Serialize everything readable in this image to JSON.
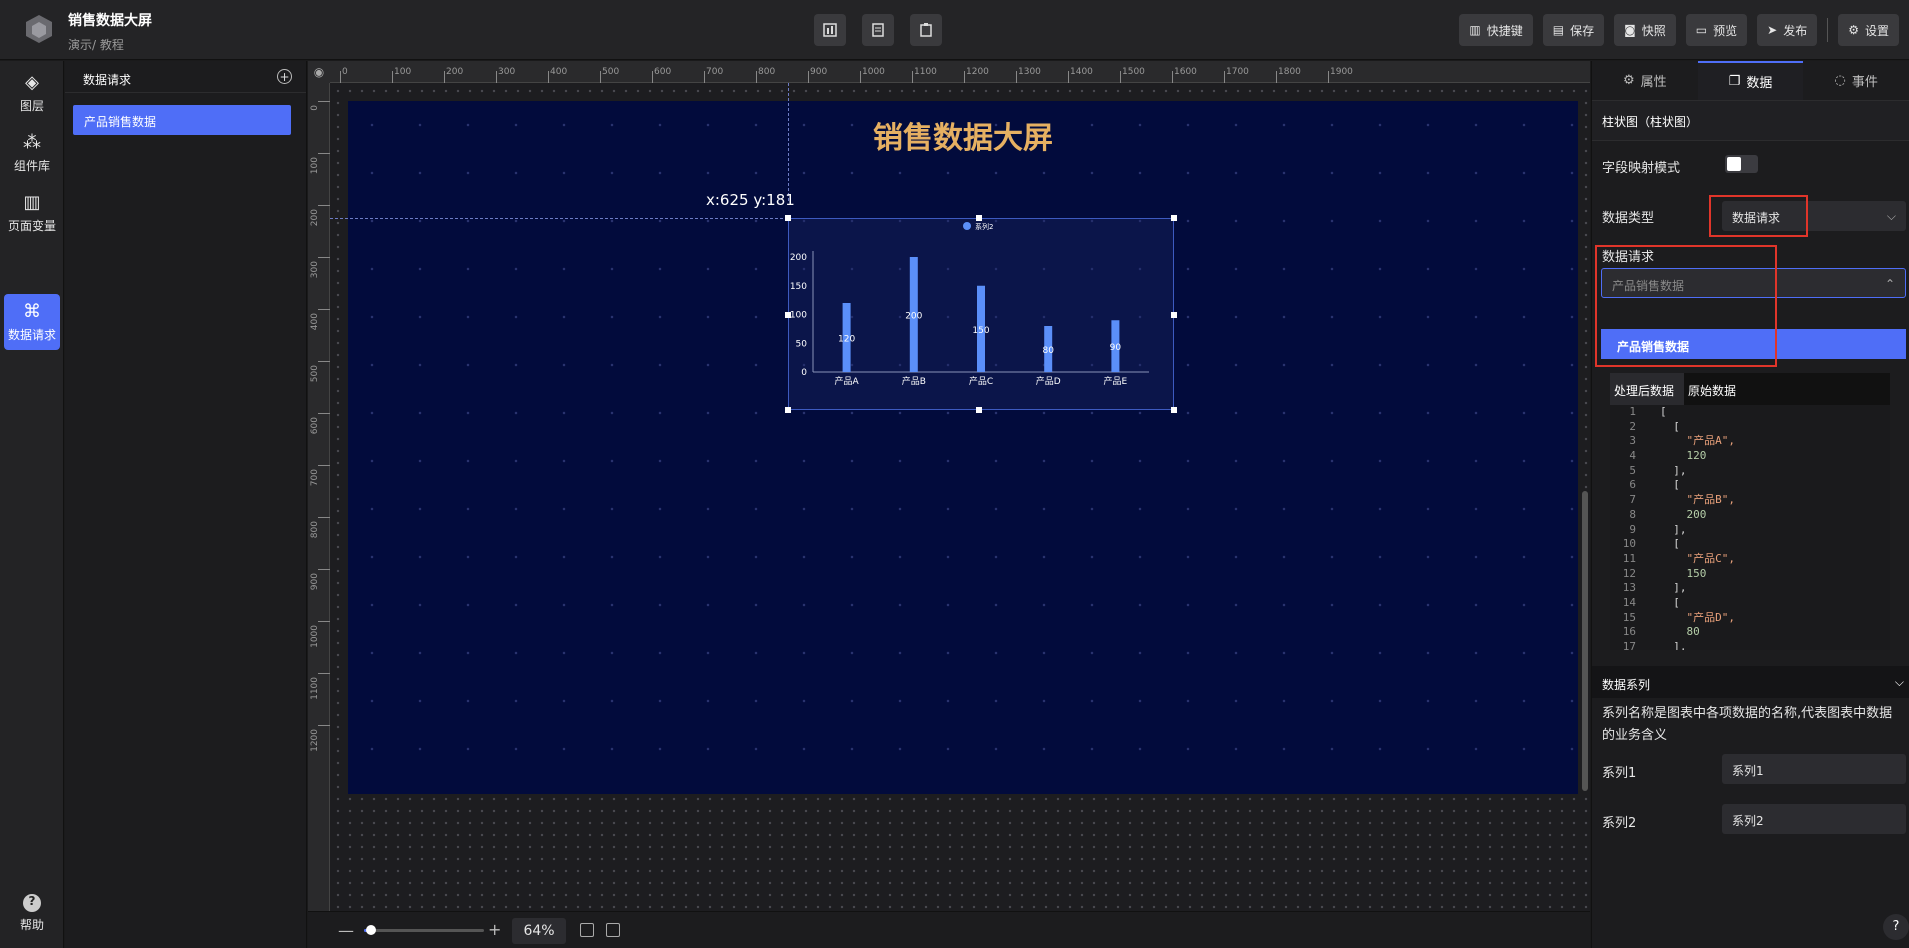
{
  "app": {
    "title": "销售数据大屏",
    "crumb": "演示/ 教程"
  },
  "toolbar": {
    "shortcut": "快捷键",
    "save": "保存",
    "snapshot": "快照",
    "preview": "预览",
    "publish": "发布",
    "settings": "设置"
  },
  "rail": {
    "layers": "图层",
    "components": "组件库",
    "variables": "页面变量",
    "requests": "数据请求",
    "help": "帮助"
  },
  "leftpanel": {
    "title": "数据请求",
    "item": "产品销售数据"
  },
  "canvas": {
    "screen_title": "销售数据大屏",
    "coord": "x:625 y:181",
    "zoom": "64%"
  },
  "ruler": {
    "h": [
      "0",
      "100",
      "200",
      "300",
      "400",
      "500",
      "600",
      "700",
      "800",
      "900",
      "1000",
      "1100",
      "1200",
      "1300",
      "1400",
      "1500",
      "1600",
      "1700",
      "1800",
      "1900"
    ],
    "v": [
      "0",
      "100",
      "200",
      "300",
      "400",
      "500",
      "600",
      "700",
      "800",
      "900",
      "1000",
      "1100",
      "1200"
    ]
  },
  "chart_data": {
    "type": "bar",
    "categories": [
      "产品A",
      "产品B",
      "产品C",
      "产品D",
      "产品E"
    ],
    "series": [
      {
        "name": "系列2",
        "values": [
          120,
          200,
          150,
          80,
          90
        ]
      }
    ],
    "ylim": [
      0,
      200
    ],
    "yticks": [
      "0",
      "50",
      "100",
      "150",
      "200"
    ],
    "color": "#5b8ff9",
    "legend": "top-center"
  },
  "rightpanel": {
    "tabs": {
      "props": "属性",
      "data": "数据",
      "events": "事件"
    },
    "component": "柱状图（柱状图）",
    "field_map_label": "字段映射模式",
    "data_type_label": "数据类型",
    "data_type_value": "数据请求",
    "request_label": "数据请求",
    "request_placeholder": "产品销售数据",
    "request_option": "产品销售数据",
    "code_tab_processed": "处理后数据",
    "code_tab_raw": "原始数据",
    "code_lines": [
      "[",
      "  [",
      "    \"产品A\",",
      "    120",
      "  ],",
      "  [",
      "    \"产品B\",",
      "    200",
      "  ],",
      "  [",
      "    \"产品C\",",
      "    150",
      "  ],",
      "  [",
      "    \"产品D\",",
      "    80",
      "  ],"
    ],
    "series_section": "数据系列",
    "series_desc": "系列名称是图表中各项数据的名称,代表图表中数据的业务含义",
    "series1_label": "系列1",
    "series1_value": "系列1",
    "series2_label": "系列2",
    "series2_value": "系列2"
  }
}
